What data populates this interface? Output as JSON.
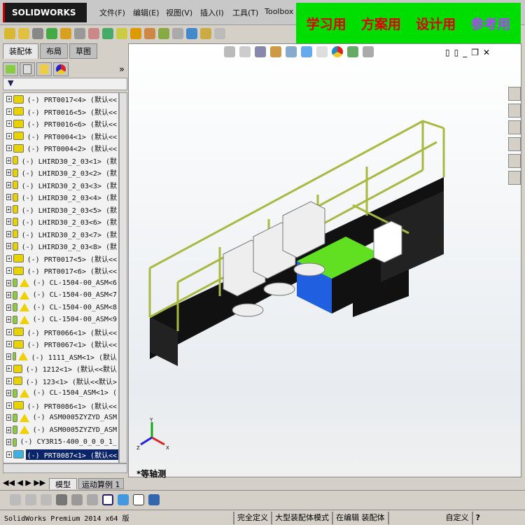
{
  "app": {
    "logo": "SOLIDWORKS",
    "menus": [
      "文件(F)",
      "编辑(E)",
      "视图(V)",
      "插入(I)",
      "工具(T)",
      "Toolbox"
    ]
  },
  "banner": {
    "items": [
      {
        "text": "学习用",
        "color": "#e00000"
      },
      {
        "text": "方案用",
        "color": "#e00000"
      },
      {
        "text": "设计用",
        "color": "#e00000"
      },
      {
        "text": "参考用",
        "color": "#b040ff"
      }
    ]
  },
  "tabs": [
    "装配体",
    "布局",
    "草图"
  ],
  "manager": {
    "more": "»",
    "filter_icon": "filter-icon"
  },
  "tree": [
    {
      "name": "(-) PRT0017<4> (默认<<",
      "type": "part"
    },
    {
      "name": "(-) PRT0016<5> (默认<<",
      "type": "part"
    },
    {
      "name": "(-) PRT0016<6> (默认<<",
      "type": "part"
    },
    {
      "name": "(-) PRT0004<1> (默认<<",
      "type": "part"
    },
    {
      "name": "(-) PRT0004<2> (默认<<",
      "type": "part"
    },
    {
      "name": "(-) LHIRD30_2_03<1> (默",
      "type": "part"
    },
    {
      "name": "(-) LHIRD30_2_03<2> (默",
      "type": "part"
    },
    {
      "name": "(-) LHIRD30_2_03<3> (默",
      "type": "part"
    },
    {
      "name": "(-) LHIRD30_2_03<4> (默",
      "type": "part"
    },
    {
      "name": "(-) LHIRD30_2_03<5> (默",
      "type": "part"
    },
    {
      "name": "(-) LHIRD30_2_03<6> (默",
      "type": "part"
    },
    {
      "name": "(-) LHIRD30_2_03<7> (默",
      "type": "part"
    },
    {
      "name": "(-) LHIRD30_2_03<8> (默",
      "type": "part"
    },
    {
      "name": "(-) PRT0017<5> (默认<<",
      "type": "part"
    },
    {
      "name": "(-) PRT0017<6> (默认<<",
      "type": "part"
    },
    {
      "name": "(-) CL-1504-00_ASM<6",
      "type": "asm-warn"
    },
    {
      "name": "(-) CL-1504-00_ASM<7",
      "type": "asm-warn"
    },
    {
      "name": "(-) CL-1504-00_ASM<8",
      "type": "asm-warn"
    },
    {
      "name": "(-) CL-1504-00_ASM<9",
      "type": "asm-warn"
    },
    {
      "name": "(-) PRT0066<1> (默认<<",
      "type": "part"
    },
    {
      "name": "(-) PRT0067<1> (默认<<",
      "type": "part"
    },
    {
      "name": "(-) 1111_ASM<1> (默认",
      "type": "asm-warn"
    },
    {
      "name": "(-) 1212<1> (默认<<默认",
      "type": "part"
    },
    {
      "name": "(-) 123<1> (默认<<默认>",
      "type": "part"
    },
    {
      "name": "(-) CL-1504_ASM<1> (",
      "type": "asm-warn"
    },
    {
      "name": "(-) PRT0086<1> (默认<<",
      "type": "part"
    },
    {
      "name": "(-) ASM0005ZYZYD_ASM",
      "type": "asm-warn"
    },
    {
      "name": "(-) ASM0005ZYZYD_ASM",
      "type": "asm-warn"
    },
    {
      "name": "(-) CY3R15-400_0_0_0_1_",
      "type": "asm"
    },
    {
      "name": "(-) PRT0087<1> (默认<<",
      "type": "selected"
    }
  ],
  "bottom_tabs": [
    "模型",
    "运动算例 1"
  ],
  "viewport": {
    "view_label": "*等轴测",
    "axes": {
      "x": "X",
      "y": "Y",
      "z": "Z"
    }
  },
  "status": {
    "product": "SolidWorks Premium 2014 x64 版",
    "fully_defined": "完全定义",
    "large_mode": "大型装配体模式",
    "editing": "在编辑 装配体",
    "custom": "自定义",
    "help": "?"
  }
}
